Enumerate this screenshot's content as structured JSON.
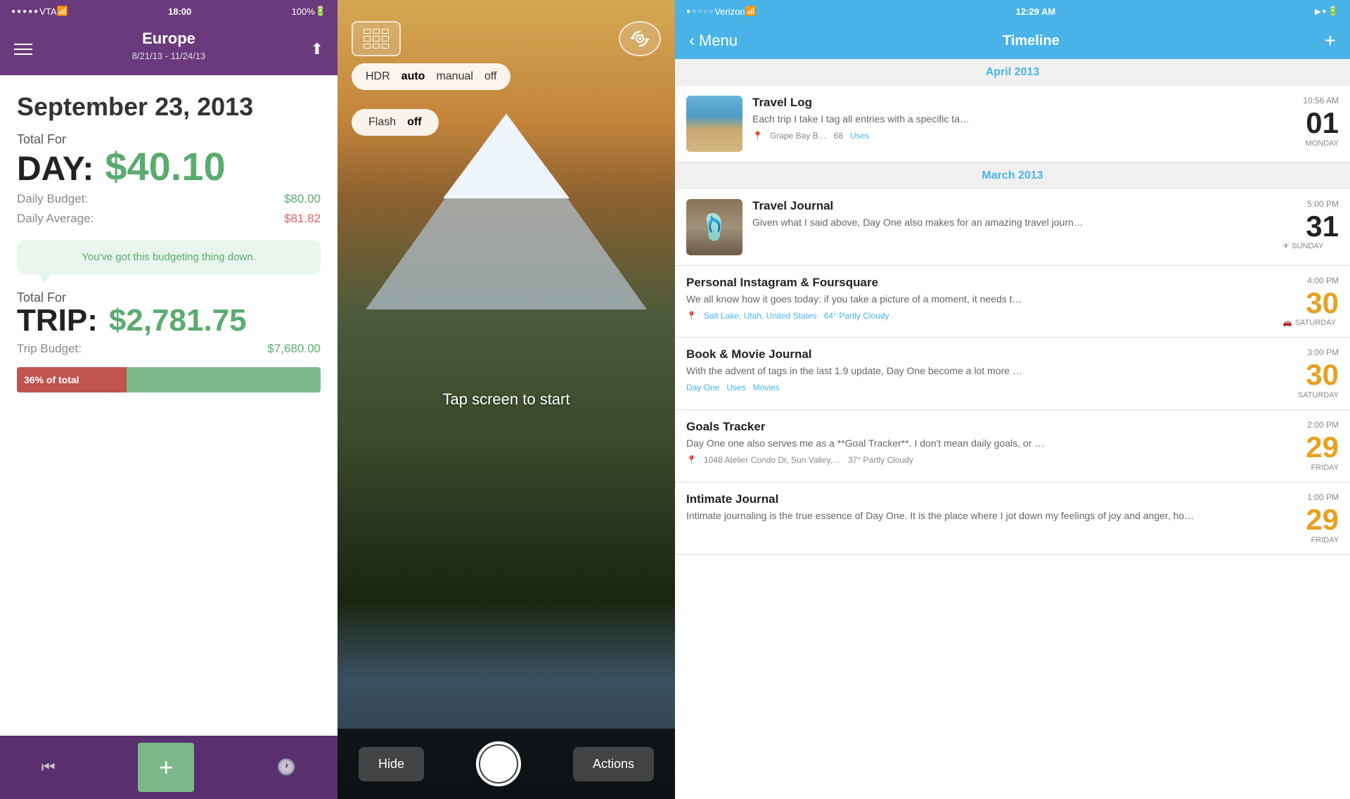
{
  "panel1": {
    "status": {
      "dots": "●●●●●",
      "carrier": "VTA",
      "wifi": "WiFi",
      "time": "18:00",
      "battery": "100%"
    },
    "header": {
      "title": "Europe",
      "subtitle": "8/21/13 - 11/24/13"
    },
    "date": "September 23, 2013",
    "day_section": {
      "label_line1": "Total For",
      "label_line2": "DAY:",
      "value": "$40.10",
      "budget_label": "Daily Budget:",
      "budget_value": "$80.00",
      "average_label": "Daily Average:",
      "average_value": "$81.82"
    },
    "message": "You've got this budgeting thing down.",
    "trip_section": {
      "label_line1": "Total For",
      "label_line2": "TRIP:",
      "value": "$2,781.75",
      "budget_label": "Trip Budget:",
      "budget_value": "$7,680.00",
      "progress_label": "36% of total",
      "progress_pct": 36
    }
  },
  "panel2": {
    "hdr": {
      "label": "HDR",
      "options": [
        "auto",
        "manual",
        "off"
      ],
      "selected": "auto"
    },
    "flash": {
      "label": "Flash",
      "selected": "off"
    },
    "tap_text": "Tap screen to start",
    "hide_btn": "Hide",
    "actions_btn": "Actions"
  },
  "panel3": {
    "status": {
      "dots": "●○○○○",
      "carrier": "Verizon",
      "time": "12:29 AM",
      "bluetooth": "BT",
      "battery": "100%"
    },
    "nav": {
      "back_label": "Menu",
      "title": "Timeline",
      "plus": "+"
    },
    "sections": [
      {
        "month": "April 2013",
        "entries": [
          {
            "has_thumb": true,
            "thumb_type": "beach",
            "title": "Travel Log",
            "text": "Each trip I take I tag all entries with a specific ta…",
            "location": "Grape Bay B…",
            "location_num": "68",
            "tag": "Uses",
            "time": "10:56 AM",
            "day_num": "01",
            "day_name": "MONDAY",
            "day_highlight": false,
            "has_plane": false
          }
        ]
      },
      {
        "month": "March 2013",
        "entries": [
          {
            "has_thumb": true,
            "thumb_type": "sandal",
            "title": "Travel Journal",
            "text": "Given what I said above, Day One also makes for an amazing travel journ…",
            "location": "",
            "location_num": "",
            "tag": "",
            "time": "5:00 PM",
            "day_num": "31",
            "day_name": "SUNDAY",
            "day_highlight": false,
            "has_plane": true
          },
          {
            "has_thumb": false,
            "title": "Personal Instagram & Foursquare",
            "text": "We all know how it goes today: if you take a picture of a moment, it needs t…",
            "location": "Salt Lake, Utah, United States",
            "location_extra": "64° Partly Cloudy",
            "tag": "",
            "time": "4:00 PM",
            "day_num": "30",
            "day_name": "SATURDAY",
            "day_highlight": true,
            "has_plane": false,
            "has_car": true
          },
          {
            "has_thumb": false,
            "title": "Book & Movie Journal",
            "text": "With the advent of tags in the last 1.9 update, Day One become a lot more …",
            "location": "",
            "tags": [
              "Day One",
              "Uses",
              "Movies"
            ],
            "time": "3:00 PM",
            "day_num": "30",
            "day_name": "SATURDAY",
            "day_highlight": true,
            "has_plane": false
          },
          {
            "has_thumb": false,
            "title": "Goals Tracker",
            "text": "Day One one also serves me as a **Goal Tracker**. I don't mean daily goals, or …",
            "location": "1048 Atelier Condo Dr, Sun Valley,…",
            "location_extra": "37° Partly Cloudy",
            "time": "2:00 PM",
            "day_num": "29",
            "day_name": "FRIDAY",
            "day_highlight": true,
            "has_plane": false
          },
          {
            "has_thumb": false,
            "title": "Intimate Journal",
            "text": "Intimate journaling is the true essence of Day One. It is the place where I jot down my feelings of joy and anger, ho…",
            "location": "",
            "time": "1:00 PM",
            "day_num": "29",
            "day_name": "FRIDAY",
            "day_highlight": true,
            "has_plane": false
          }
        ]
      }
    ]
  }
}
